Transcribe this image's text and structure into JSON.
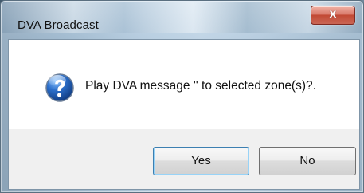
{
  "dialog": {
    "title": "DVA Broadcast",
    "message": "Play DVA message '' to selected zone(s)?."
  },
  "buttons": {
    "close": "x",
    "yes": "Yes",
    "no": "No"
  },
  "icons": {
    "question": "question-icon",
    "close": "close-icon"
  },
  "colors": {
    "accent": "#3c7fb1",
    "close_button": "#c24935",
    "question_icon": "#1f5fae"
  }
}
